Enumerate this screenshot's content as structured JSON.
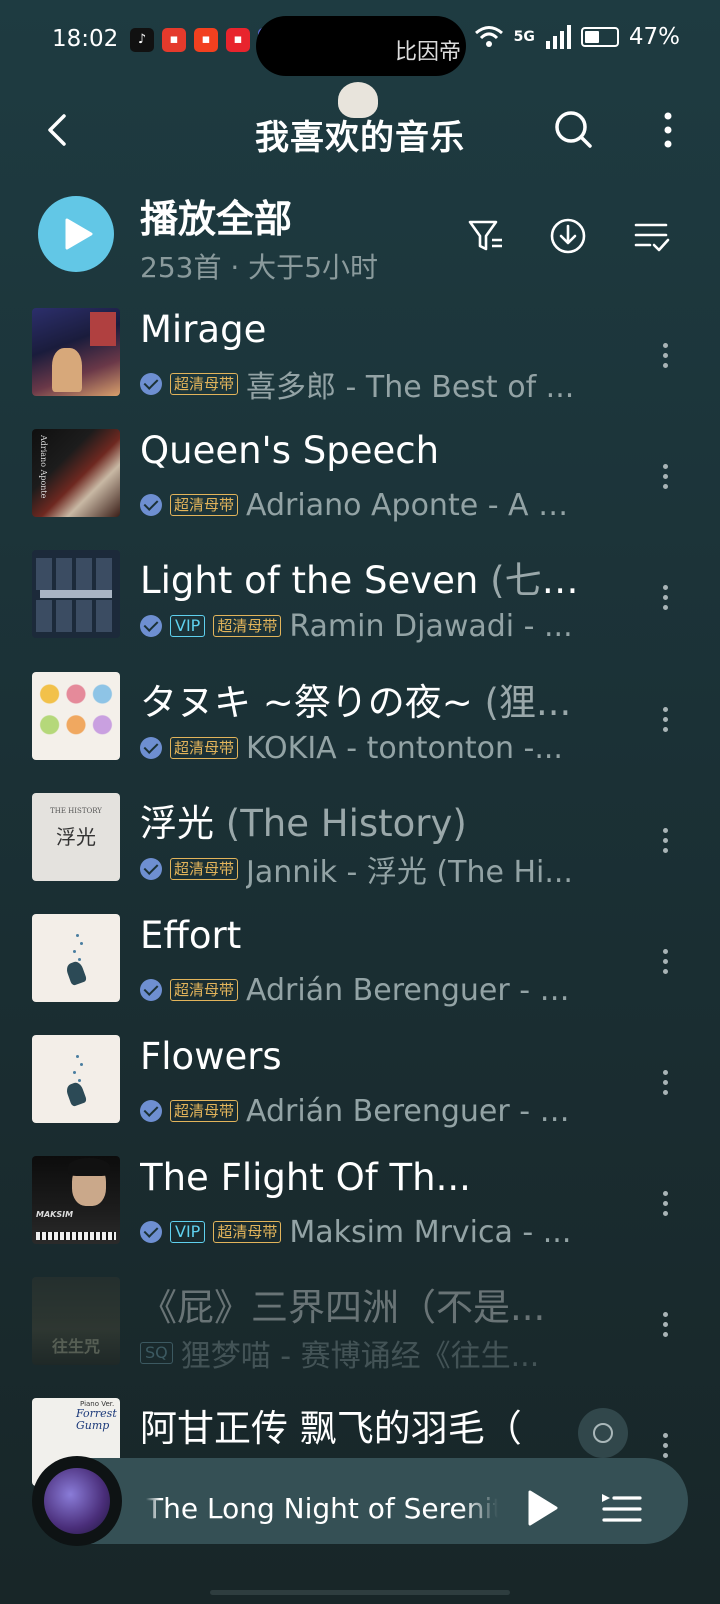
{
  "status_bar": {
    "time": "18:02",
    "island_text": "比因帝",
    "network": "5G",
    "battery_pct": "47%",
    "battery_level": 0.47
  },
  "header": {
    "title": "我喜欢的音乐"
  },
  "play_all": {
    "label": "播放全部",
    "subtitle": "253首 · 大于5小时"
  },
  "songs": [
    {
      "title": "Mirage",
      "title_extra": "",
      "vip": false,
      "hq": true,
      "sq": false,
      "artist": "喜多郎 - The Best of ...",
      "disabled": false
    },
    {
      "title": "Queen's Speech",
      "title_extra": "",
      "vip": false,
      "hq": true,
      "sq": false,
      "artist": "Adriano Aponte - A Q...",
      "disabled": false
    },
    {
      "title": "Light of the Seven",
      "title_extra": " (七神...",
      "vip": true,
      "hq": true,
      "sq": false,
      "artist": "Ramin Djawadi - ...",
      "disabled": false
    },
    {
      "title": "タヌキ ~祭りの夜~",
      "title_extra": " (狸...",
      "vip": false,
      "hq": true,
      "sq": false,
      "artist": "KOKIA - tontonton -...",
      "disabled": false
    },
    {
      "title": "浮光",
      "title_extra": " (The History)",
      "vip": false,
      "hq": true,
      "sq": false,
      "artist": "Jannik - 浮光 (The Hi...",
      "disabled": false
    },
    {
      "title": "Effort",
      "title_extra": "",
      "vip": false,
      "hq": true,
      "sq": false,
      "artist": "Adrián Berenguer - S...",
      "disabled": false
    },
    {
      "title": "Flowers",
      "title_extra": "",
      "vip": false,
      "hq": true,
      "sq": false,
      "artist": "Adrián Berenguer - S...",
      "disabled": false
    },
    {
      "title": "The Flight Of Th...",
      "title_extra": "",
      "vip": true,
      "hq": true,
      "sq": false,
      "artist": "Maksim Mrvica - ...",
      "disabled": false
    },
    {
      "title": "《屁》三界四洲（不是...",
      "title_extra": "",
      "vip": false,
      "hq": false,
      "sq": true,
      "artist": "狸梦喵 - 赛博诵经《往生...",
      "disabled": true
    },
    {
      "title": "阿甘正传 飘飞的羽毛（",
      "title_extra": "",
      "vip": false,
      "hq": false,
      "sq": false,
      "artist": "",
      "disabled": false
    }
  ],
  "badges": {
    "hq": "超清母带",
    "vip": "VIP",
    "sq": "SQ"
  },
  "cover_text": {
    "queens": "Adriano Aponte",
    "history": "THE HISTORY",
    "history_glyph": "浮光",
    "maksim": "MAKSIM",
    "shengwang": "往生咒",
    "forrest": "Forrest Gump",
    "forrest_top": "Piano Ver."
  },
  "player": {
    "title": "The Long Night of Serenity - I"
  },
  "icons": {
    "back": "back-icon",
    "search": "search-icon",
    "more": "more-icon",
    "filter": "filter-icon",
    "download": "download-icon",
    "sort": "sort-icon",
    "play": "play-icon",
    "queue": "queue-icon"
  },
  "colors": {
    "accent": "#62c7e6",
    "hq_badge": "#e2b45b",
    "vip_badge": "#5fd0ee",
    "verified": "#6e8fd1"
  }
}
